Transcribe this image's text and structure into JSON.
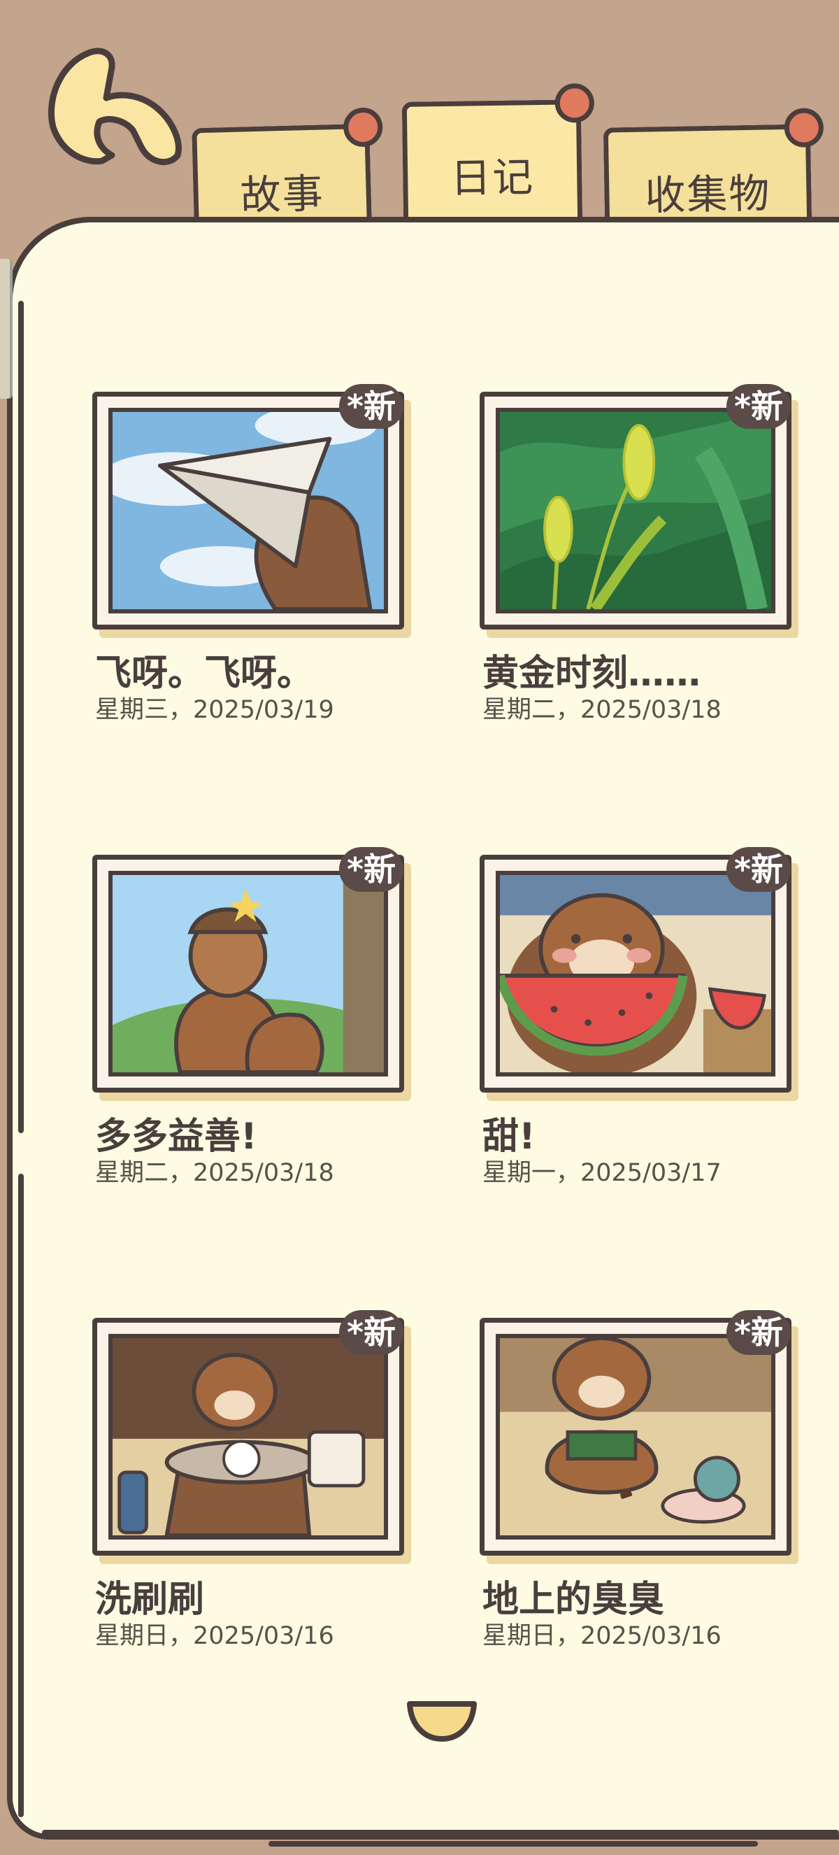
{
  "tabs": [
    {
      "label": "故事"
    },
    {
      "label": "日记"
    },
    {
      "label": "收集物"
    }
  ],
  "active_tab": "日记",
  "entries": [
    {
      "title": "飞呀。飞呀。",
      "date": "星期三，2025/03/19",
      "badge": "*新"
    },
    {
      "title": "黄金时刻……",
      "date": "星期二，2025/03/18",
      "badge": "*新"
    },
    {
      "title": "多多益善!",
      "date": "星期二，2025/03/18",
      "badge": "*新"
    },
    {
      "title": "甜!",
      "date": "星期一，2025/03/17",
      "badge": "*新"
    },
    {
      "title": "洗刷刷",
      "date": "星期日，2025/03/16",
      "badge": "*新"
    },
    {
      "title": "地上的臭臭",
      "date": "星期日，2025/03/16",
      "badge": "*新"
    }
  ],
  "colors": {
    "header_bg": "#c3a48c",
    "page_bg": "#fefbe3",
    "tab_bg": "#f4e09a",
    "pin": "#e07a5f",
    "outline": "#4a3e3d"
  }
}
